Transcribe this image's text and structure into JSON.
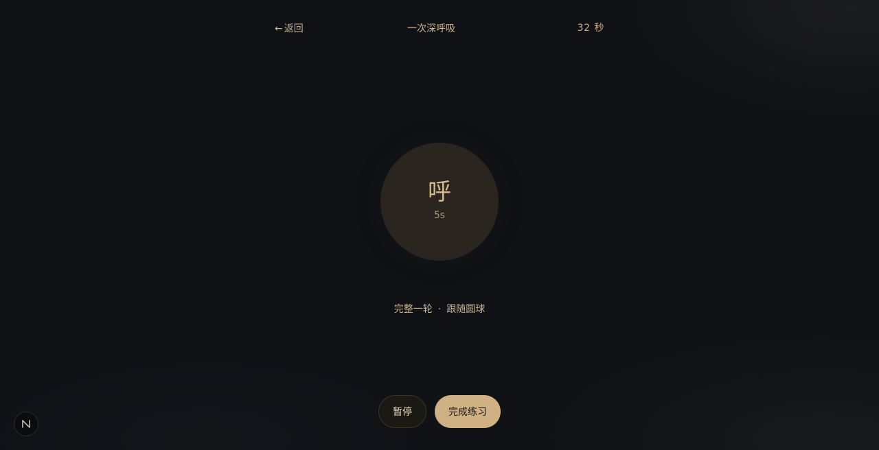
{
  "header": {
    "back_label": "返回",
    "title": "一次深呼吸",
    "timer_value": "32",
    "timer_unit": "秒"
  },
  "orb": {
    "phase": "呼",
    "seconds": "5s"
  },
  "hint": {
    "left": "完整一轮",
    "separator": "·",
    "right": "跟随圆球"
  },
  "controls": {
    "pause_label": "暂停",
    "finish_label": "完成练习"
  },
  "colors": {
    "background": "#0f1115",
    "accent_text": "#c9b38f",
    "orb_fill": "#2a251e",
    "primary_button": "#d0b184"
  },
  "icons": {
    "back": "arrow-left-icon",
    "badge": "n-logo-icon"
  }
}
